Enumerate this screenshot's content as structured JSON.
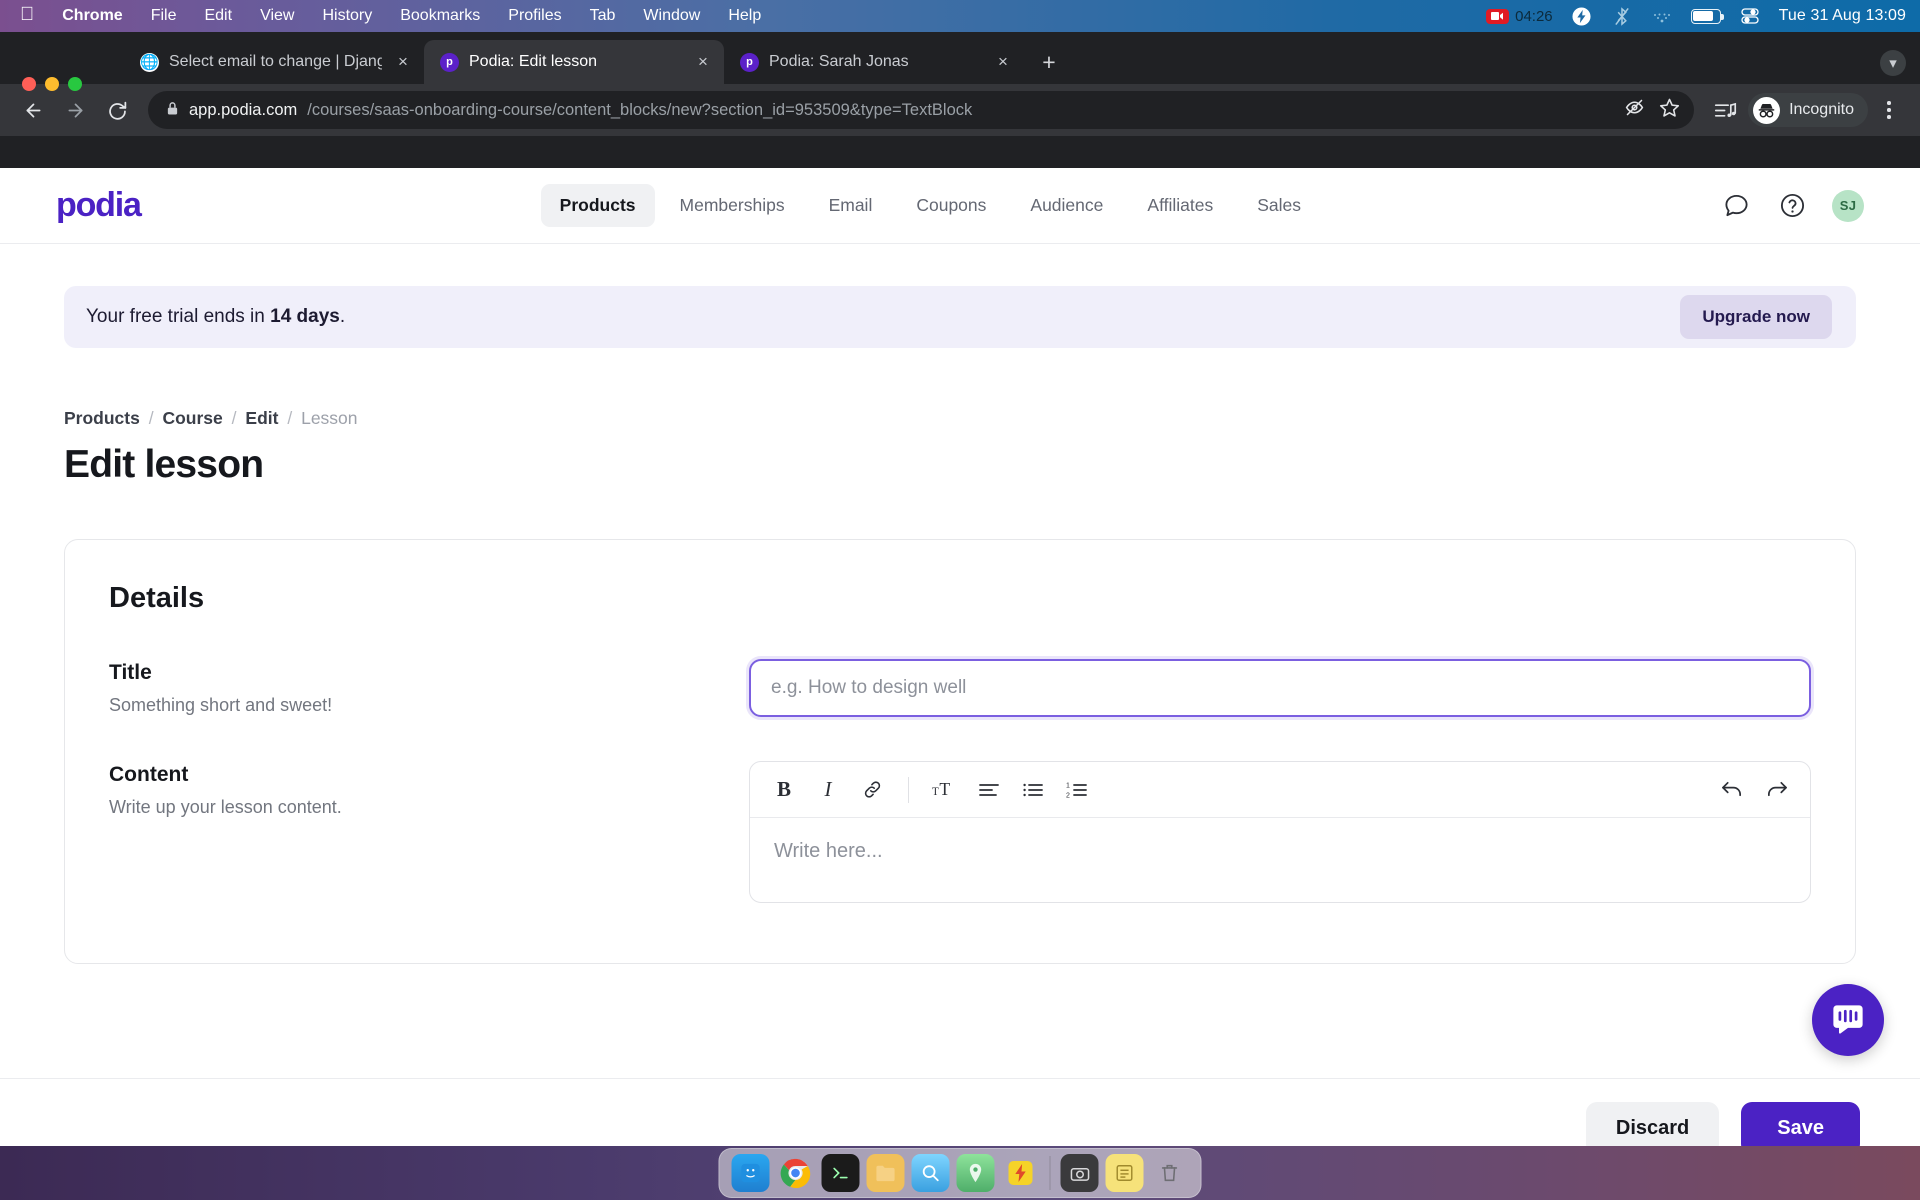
{
  "menubar": {
    "apple_icon": "apple-logo",
    "items": [
      {
        "label": "Chrome",
        "bold": true
      },
      {
        "label": "File",
        "bold": false
      },
      {
        "label": "Edit",
        "bold": false
      },
      {
        "label": "View",
        "bold": false
      },
      {
        "label": "History",
        "bold": false
      },
      {
        "label": "Bookmarks",
        "bold": false
      },
      {
        "label": "Profiles",
        "bold": false
      },
      {
        "label": "Tab",
        "bold": false
      },
      {
        "label": "Window",
        "bold": false
      },
      {
        "label": "Help",
        "bold": false
      }
    ],
    "recording_time": "04:26",
    "clock": "Tue 31 Aug  13:09",
    "tray_icons": [
      "record-stop-icon",
      "bolt-icon",
      "bluetooth-off-icon",
      "wifi-weak-icon",
      "battery-icon",
      "control-center-icon"
    ]
  },
  "browser": {
    "tabs": [
      {
        "title": "Select email to change | Djang",
        "favicon": "globe-icon",
        "active": false,
        "close": "×"
      },
      {
        "title": "Podia: Edit lesson",
        "favicon": "podia-favicon",
        "active": true,
        "close": "×"
      },
      {
        "title": "Podia: Sarah Jonas",
        "favicon": "podia-favicon",
        "active": false,
        "close": "×"
      }
    ],
    "new_tab_label": "+",
    "toolbar": {
      "back_icon": "back-arrow-icon",
      "forward_icon": "forward-arrow-icon",
      "reload_icon": "reload-icon",
      "lock_icon": "lock-icon",
      "url_host": "app.podia.com",
      "url_path": "/courses/saas-onboarding-course/content_blocks/new?section_id=953509&type=TextBlock",
      "third_party_cookies_icon": "eye-slash-icon",
      "bookmark_icon": "star-icon",
      "media_icon": "media-list-icon",
      "profile_label": "Incognito",
      "profile_icon": "incognito-icon",
      "menu_icon": "kebab-menu-icon"
    }
  },
  "site": {
    "logo": "podia",
    "nav": [
      {
        "label": "Products",
        "active": true
      },
      {
        "label": "Memberships",
        "active": false
      },
      {
        "label": "Email",
        "active": false
      },
      {
        "label": "Coupons",
        "active": false
      },
      {
        "label": "Audience",
        "active": false
      },
      {
        "label": "Affiliates",
        "active": false
      },
      {
        "label": "Sales",
        "active": false
      }
    ],
    "header_icons": [
      "chat-bubble-icon",
      "help-circle-icon"
    ],
    "avatar_initials": "SJ",
    "avatar_bg": "#b7e3c6"
  },
  "banner": {
    "text_prefix": "Your free trial ends in ",
    "days": "14 days",
    "text_suffix": ".",
    "button_label": "Upgrade now",
    "bg": "#f0effa"
  },
  "breadcrumb": {
    "items": [
      "Products",
      "Course",
      "Edit"
    ],
    "current": "Lesson",
    "separator": "/"
  },
  "page": {
    "title": "Edit lesson"
  },
  "card": {
    "title": "Details",
    "fields": [
      {
        "label": "Title",
        "help": "Something short and sweet!",
        "value": "",
        "placeholder": "e.g. How to design well",
        "focused": true
      },
      {
        "label": "Content",
        "help": "Write up your lesson content.",
        "placeholder": "Write here..."
      }
    ]
  },
  "editor": {
    "tools": [
      {
        "name": "bold-icon",
        "glyph": "B"
      },
      {
        "name": "italic-icon",
        "glyph": "I"
      },
      {
        "name": "link-icon",
        "glyph": "🔗"
      },
      {
        "name": "separator",
        "glyph": ""
      },
      {
        "name": "text-size-icon",
        "glyph": "ᴛT"
      },
      {
        "name": "align-left-icon",
        "glyph": ""
      },
      {
        "name": "bullet-list-icon",
        "glyph": ""
      },
      {
        "name": "numbered-list-icon",
        "glyph": ""
      }
    ],
    "undo_icon": "undo-icon",
    "redo_icon": "redo-icon"
  },
  "footer": {
    "discard_label": "Discard",
    "save_label": "Save",
    "save_bg": "#4b22c4"
  },
  "support": {
    "widget_icon": "intercom-chat-icon",
    "widget_bg": "#4b22c4"
  },
  "dock": {
    "items": [
      "finder-icon",
      "chrome-icon",
      "terminal-icon",
      "files-icon",
      "preview-icon",
      "maps-icon",
      "bolt-icon",
      "separator",
      "screenshot-icon",
      "notes-icon",
      "trash-icon"
    ]
  }
}
